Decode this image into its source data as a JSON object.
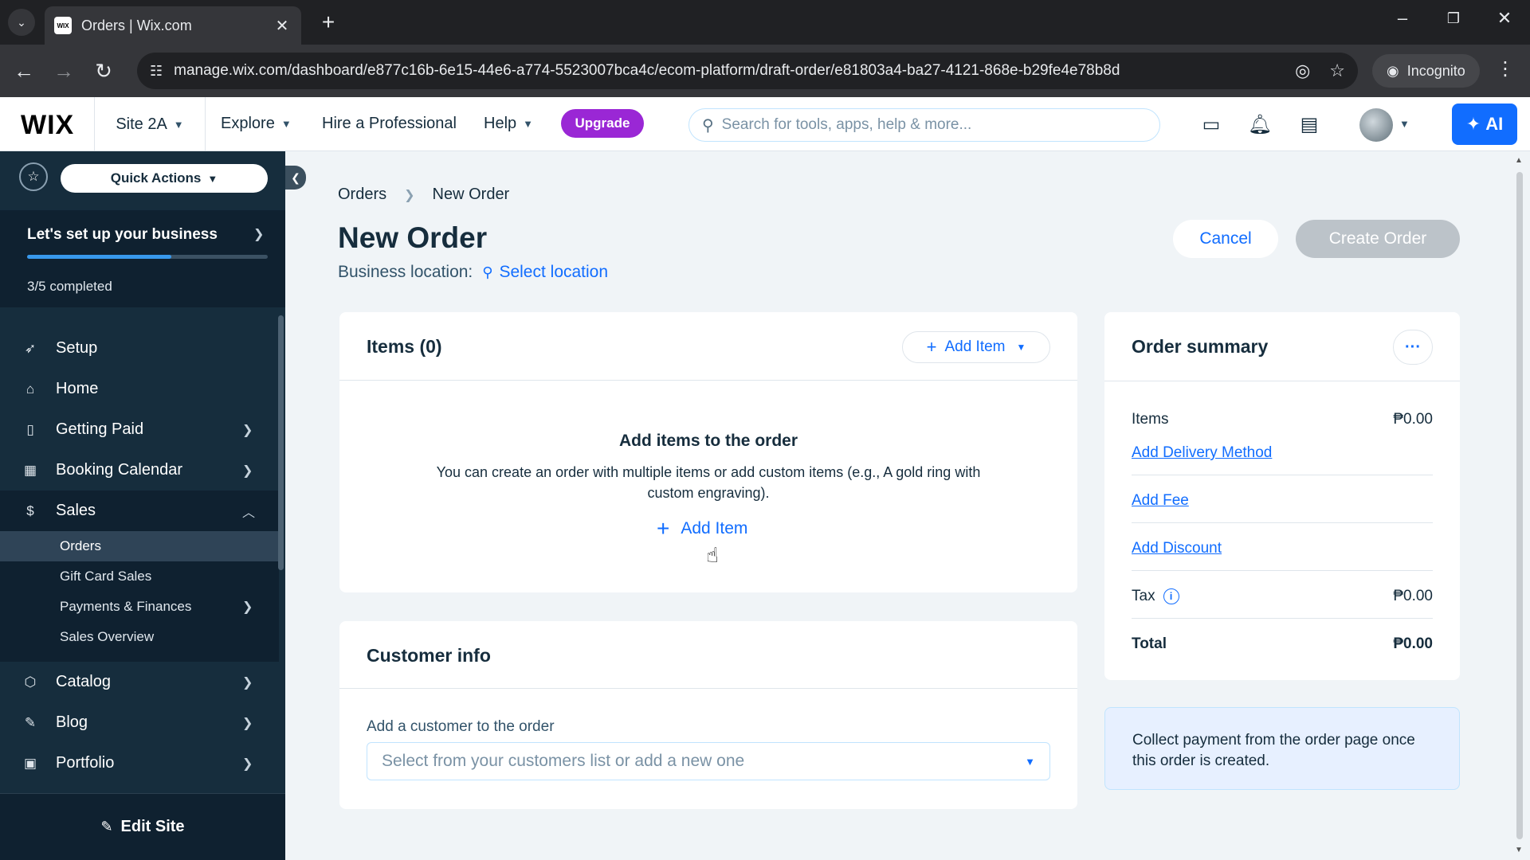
{
  "browser": {
    "tab_title": "Orders | Wix.com",
    "favicon": "WIX",
    "url": "manage.wix.com/dashboard/e877c16b-6e15-44e6-a774-5523007bca4c/ecom-platform/draft-order/e81803a4-ba27-4121-868e-b29fe4e78b8d",
    "incognito_label": "Incognito"
  },
  "topbar": {
    "logo": "WIX",
    "site_name": "Site 2A",
    "explore": "Explore",
    "hire": "Hire a Professional",
    "help": "Help",
    "upgrade": "Upgrade",
    "search_placeholder": "Search for tools, apps, help & more...",
    "ai_label": "AI",
    "colors": {
      "upgrade": "#9a27d5",
      "ai": "#116dff"
    }
  },
  "sidebar": {
    "quick_actions": "Quick Actions",
    "setup_title": "Let's set up your business",
    "setup_progress": 0.6,
    "setup_completed": "3/5 completed",
    "items": [
      {
        "label": "Setup",
        "icon": "rocket-icon"
      },
      {
        "label": "Home",
        "icon": "home-icon"
      },
      {
        "label": "Getting Paid",
        "icon": "invoice-icon"
      },
      {
        "label": "Booking Calendar",
        "icon": "calendar-icon"
      },
      {
        "label": "Sales",
        "icon": "dollar-icon"
      }
    ],
    "sales_sub": [
      "Orders",
      "Gift Card Sales",
      "Payments & Finances",
      "Sales Overview"
    ],
    "items_after": [
      {
        "label": "Catalog",
        "icon": "tag-icon"
      },
      {
        "label": "Blog",
        "icon": "pen-icon"
      },
      {
        "label": "Portfolio",
        "icon": "portfolio-icon"
      }
    ],
    "edit_site": "Edit Site"
  },
  "main": {
    "breadcrumb": [
      "Orders",
      "New Order"
    ],
    "title": "New Order",
    "business_location_label": "Business location:",
    "select_location": "Select location",
    "cancel": "Cancel",
    "create_order": "Create Order",
    "items": {
      "title": "Items (0)",
      "add_item": "Add Item",
      "empty_title": "Add items to the order",
      "empty_desc": "You can create an order with multiple items or add custom items (e.g., A gold ring with custom engraving).",
      "add_item_center": "Add Item"
    },
    "customer": {
      "title": "Customer info",
      "label": "Add a customer to the order",
      "placeholder": "Select from your customers list or add a new one"
    },
    "summary": {
      "title": "Order summary",
      "items_label": "Items",
      "items_value": "₱0.00",
      "add_delivery": "Add Delivery Method",
      "add_fee": "Add Fee",
      "add_discount": "Add Discount",
      "tax_label": "Tax",
      "tax_value": "₱0.00",
      "total_label": "Total",
      "total_value": "₱0.00"
    },
    "payment_note": "Collect payment from the order page once this order is created."
  }
}
